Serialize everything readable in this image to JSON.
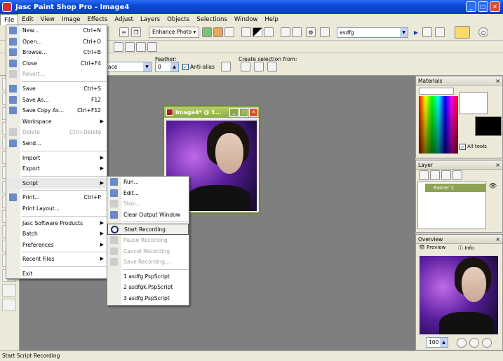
{
  "window": {
    "title": "Jasc Paint Shop Pro - Image4"
  },
  "menubar": [
    "File",
    "Edit",
    "View",
    "Image",
    "Effects",
    "Adjust",
    "Layers",
    "Objects",
    "Selections",
    "Window",
    "Help"
  ],
  "toolbar": {
    "enhance_photo": "Enhance Photo",
    "script_select": "asdfg"
  },
  "options": {
    "mode_value": "ace",
    "feather_label": "Feather:",
    "feather_value": "0",
    "antialias_label": "Anti-alias",
    "create_sel_label": "Create selection from:"
  },
  "image_window": {
    "title": "Image4* @ 1..."
  },
  "file_menu": [
    {
      "label": "New...",
      "shortcut": "Ctrl+N",
      "icon": "new-icon",
      "disabled": false
    },
    {
      "label": "Open...",
      "shortcut": "Ctrl+O",
      "icon": "open-icon",
      "disabled": false
    },
    {
      "label": "Browse...",
      "shortcut": "Ctrl+B",
      "icon": "browse-icon",
      "disabled": false
    },
    {
      "label": "Close",
      "shortcut": "Ctrl+F4",
      "icon": "close-file-icon",
      "disabled": false
    },
    {
      "label": "Revert...",
      "shortcut": "",
      "icon": "revert-icon",
      "disabled": true
    },
    {
      "sep": true
    },
    {
      "label": "Save",
      "shortcut": "Ctrl+S",
      "icon": "save-icon",
      "disabled": false
    },
    {
      "label": "Save As...",
      "shortcut": "F12",
      "icon": "save-as-icon",
      "disabled": false
    },
    {
      "label": "Save Copy As...",
      "shortcut": "Ctrl+F12",
      "icon": "save-copy-icon",
      "disabled": false
    },
    {
      "label": "Workspace",
      "shortcut": "",
      "icon": "",
      "disabled": false,
      "submenu": true
    },
    {
      "label": "Delete",
      "shortcut": "Ctrl+Delete",
      "icon": "delete-icon",
      "disabled": true
    },
    {
      "label": "Send...",
      "shortcut": "",
      "icon": "send-icon",
      "disabled": false
    },
    {
      "sep": true
    },
    {
      "label": "Import",
      "shortcut": "",
      "icon": "",
      "disabled": false,
      "submenu": true
    },
    {
      "label": "Export",
      "shortcut": "",
      "icon": "",
      "disabled": false,
      "submenu": true
    },
    {
      "sep": true
    },
    {
      "label": "Script",
      "shortcut": "",
      "icon": "",
      "disabled": false,
      "submenu": true,
      "highlight": true
    },
    {
      "sep": true
    },
    {
      "label": "Print...",
      "shortcut": "Ctrl+P",
      "icon": "print-icon",
      "disabled": false
    },
    {
      "label": "Print Layout...",
      "shortcut": "",
      "icon": "",
      "disabled": false
    },
    {
      "sep": true
    },
    {
      "label": "Jasc Software Products",
      "shortcut": "",
      "icon": "",
      "disabled": false,
      "submenu": true
    },
    {
      "label": "Batch",
      "shortcut": "",
      "icon": "",
      "disabled": false,
      "submenu": true
    },
    {
      "label": "Preferences",
      "shortcut": "",
      "icon": "",
      "disabled": false,
      "submenu": true
    },
    {
      "sep": true
    },
    {
      "label": "Recent Files",
      "shortcut": "",
      "icon": "",
      "disabled": false,
      "submenu": true
    },
    {
      "sep": true
    },
    {
      "label": "Exit",
      "shortcut": "",
      "icon": "",
      "disabled": false
    }
  ],
  "script_menu": [
    {
      "label": "Run...",
      "icon": "run-icon",
      "disabled": false
    },
    {
      "label": "Edit...",
      "icon": "edit-icon",
      "disabled": false
    },
    {
      "label": "Stop...",
      "icon": "stop-icon",
      "disabled": true
    },
    {
      "label": "Clear Output Window",
      "icon": "clear-output-icon",
      "disabled": false
    },
    {
      "sep": true
    },
    {
      "label": "Start Recording",
      "icon": "record-icon",
      "disabled": false,
      "highlight": true
    },
    {
      "label": "Pause Recording",
      "icon": "pause-icon",
      "disabled": true
    },
    {
      "label": "Cancel Recording",
      "icon": "cancel-icon",
      "disabled": true
    },
    {
      "label": "Save Recording...",
      "icon": "save-recording-icon",
      "disabled": true
    },
    {
      "sep": true
    },
    {
      "label": "1 asdfg.PspScript",
      "icon": "",
      "disabled": false
    },
    {
      "label": "2 asdfgk.PspScript",
      "icon": "",
      "disabled": false
    },
    {
      "label": "3 asdfg.PspScript",
      "icon": "",
      "disabled": false
    }
  ],
  "materials": {
    "title": "Materials",
    "all_tools": "All tools"
  },
  "layer": {
    "title": "Layer",
    "item": "Raster 1"
  },
  "overview": {
    "title": "Overview",
    "tab_preview": "Preview",
    "tab_info": "Info",
    "zoom": "100"
  },
  "status": "Start Script Recording",
  "colors": {
    "titlebar": "#0a48d8",
    "workspace": "#7f7f7f",
    "imgwin_border": "#6b8a30"
  }
}
